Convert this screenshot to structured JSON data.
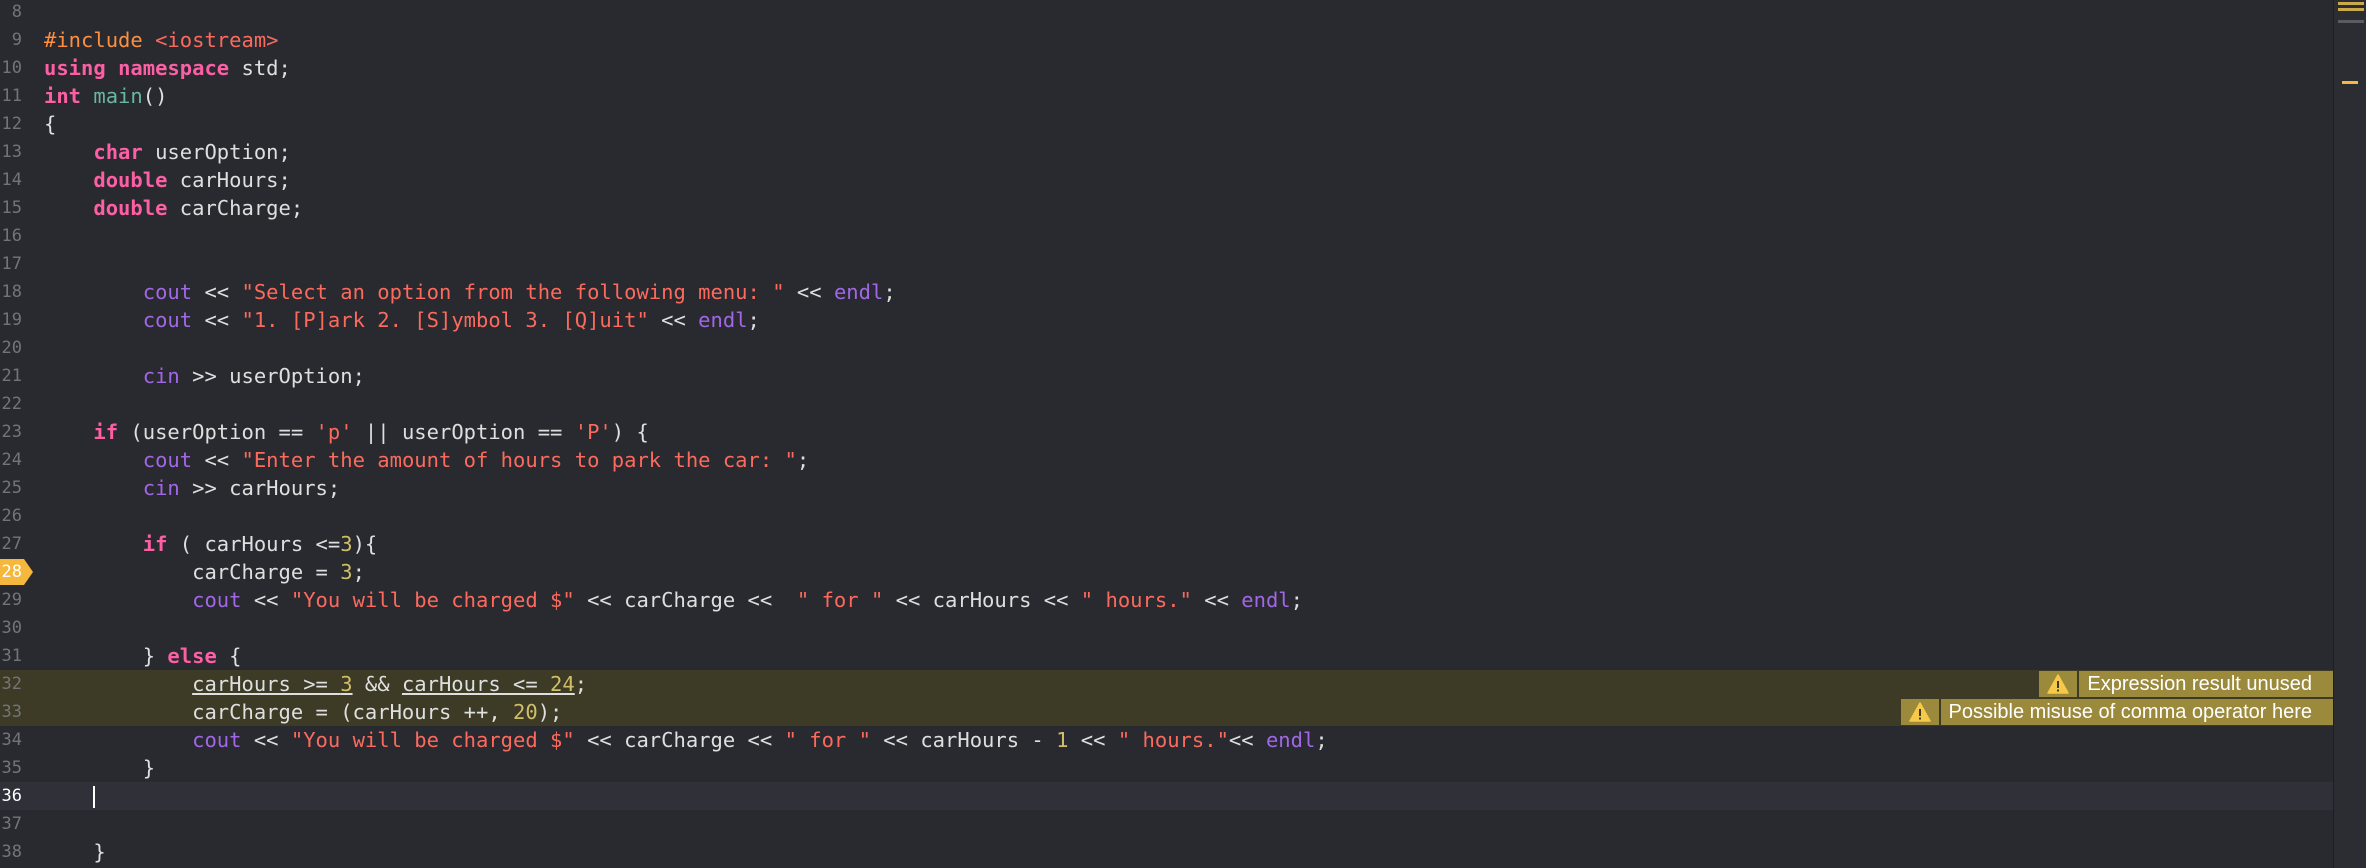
{
  "editor": {
    "language": "C++",
    "current_line": 36,
    "breakpoint_line": 28,
    "lines": [
      {
        "n": "8",
        "code": ""
      },
      {
        "n": "9",
        "code": "#include <iostream>"
      },
      {
        "n": "10",
        "code": "using namespace std;"
      },
      {
        "n": "11",
        "code": "int main()"
      },
      {
        "n": "12",
        "code": "{"
      },
      {
        "n": "13",
        "code": "    char userOption;"
      },
      {
        "n": "14",
        "code": "    double carHours;"
      },
      {
        "n": "15",
        "code": "    double carCharge;"
      },
      {
        "n": "16",
        "code": ""
      },
      {
        "n": "17",
        "code": ""
      },
      {
        "n": "18",
        "code": "        cout << \"Select an option from the following menu: \" << endl;"
      },
      {
        "n": "19",
        "code": "        cout << \"1. [P]ark 2. [S]ymbol 3. [Q]uit\" << endl;"
      },
      {
        "n": "20",
        "code": ""
      },
      {
        "n": "21",
        "code": "        cin >> userOption;"
      },
      {
        "n": "22",
        "code": ""
      },
      {
        "n": "23",
        "code": "    if (userOption == 'p' || userOption == 'P') {"
      },
      {
        "n": "24",
        "code": "        cout << \"Enter the amount of hours to park the car: \";"
      },
      {
        "n": "25",
        "code": "        cin >> carHours;"
      },
      {
        "n": "26",
        "code": ""
      },
      {
        "n": "27",
        "code": "        if ( carHours <=3){"
      },
      {
        "n": "28",
        "code": "            carCharge = 3;"
      },
      {
        "n": "29",
        "code": "            cout << \"You will be charged $\" << carCharge <<  \" for \" << carHours << \" hours.\" << endl;"
      },
      {
        "n": "30",
        "code": ""
      },
      {
        "n": "31",
        "code": "        } else {"
      },
      {
        "n": "32",
        "code": "            carHours >= 3 && carHours <= 24;"
      },
      {
        "n": "33",
        "code": "            carCharge = (carHours ++, 20);"
      },
      {
        "n": "34",
        "code": "            cout << \"You will be charged $\" << carCharge << \" for \" << carHours - 1 << \" hours.\"<< endl;"
      },
      {
        "n": "35",
        "code": "        }"
      },
      {
        "n": "36",
        "code": "    "
      },
      {
        "n": "37",
        "code": ""
      },
      {
        "n": "38",
        "code": "    }"
      }
    ]
  },
  "issues": [
    {
      "line": 32,
      "severity": "warning",
      "icon": "warning-triangle-icon",
      "message": "Expression result unused"
    },
    {
      "line": 33,
      "severity": "warning",
      "icon": "warning-triangle-icon",
      "message": "Possible misuse of comma operator here"
    }
  ],
  "colors": {
    "background": "#292a30",
    "keyword": "#fc5fa3",
    "string": "#fc6a5d",
    "number": "#d0bf69",
    "preprocessor": "#fd8f3f",
    "function": "#67b7a4",
    "library": "#a167e6",
    "plain": "#dfdfe0",
    "warning_bg": "#9c8a3c",
    "warning_line": "#3d3a26",
    "breakpoint": "#f5b83d"
  }
}
